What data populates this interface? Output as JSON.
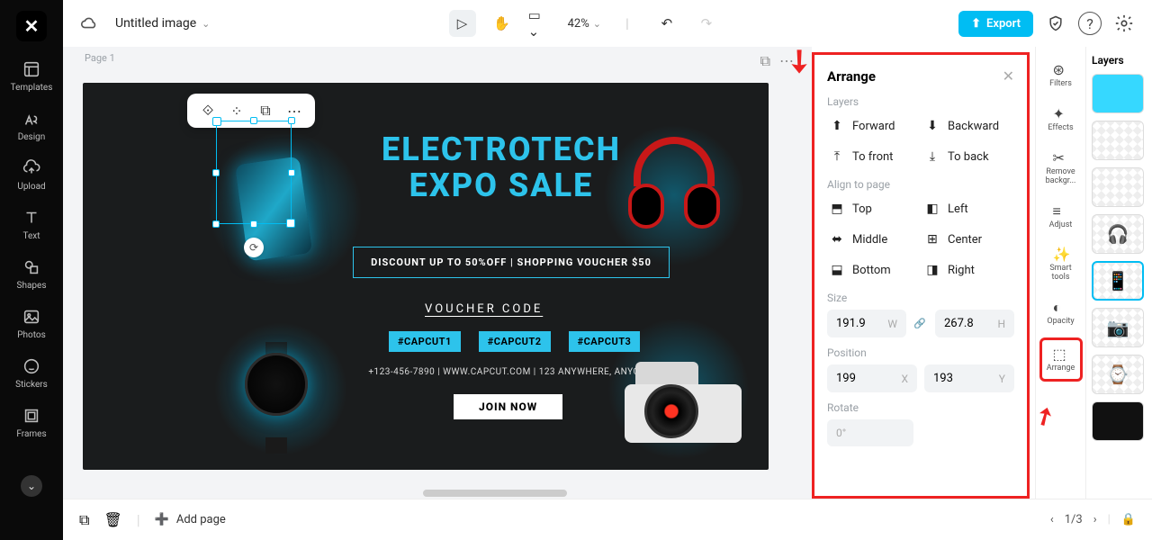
{
  "app": {
    "title": "Untitled image",
    "zoom": "42%",
    "page_label": "Page 1"
  },
  "topbar": {
    "export_label": "Export"
  },
  "rail": {
    "templates": "Templates",
    "design": "Design",
    "upload": "Upload",
    "text": "Text",
    "shapes": "Shapes",
    "photos": "Photos",
    "stickers": "Stickers",
    "frames": "Frames"
  },
  "canvas": {
    "headline": "ELECTROTECH EXPO SALE",
    "subline": "DISCOUNT UP TO 50%OFF    |    SHOPPING VOUCHER $50",
    "voucher_label": "VOUCHER CODE",
    "tags": [
      "#CAPCUT1",
      "#CAPCUT2",
      "#CAPCUT3"
    ],
    "info": "+123-456-7890   |   WWW.CAPCUT.COM   |   123 ANYWHERE, ANYCITY",
    "join": "JOIN NOW"
  },
  "arrange": {
    "title": "Arrange",
    "layers_label": "Layers",
    "forward": "Forward",
    "backward": "Backward",
    "to_front": "To front",
    "to_back": "To back",
    "align_label": "Align to page",
    "top": "Top",
    "left": "Left",
    "middle": "Middle",
    "center": "Center",
    "bottom": "Bottom",
    "right": "Right",
    "size_label": "Size",
    "w_val": "191.9",
    "h_val": "267.8",
    "position_label": "Position",
    "x_val": "199",
    "y_val": "193",
    "rotate_label": "Rotate",
    "rot_val": "0°"
  },
  "tools": {
    "filters": "Filters",
    "effects": "Effects",
    "removebg": "Remove backgr...",
    "adjust": "Adjust",
    "smart": "Smart tools",
    "opacity": "Opacity",
    "arrange": "Arrange"
  },
  "layers_title": "Layers",
  "bottom": {
    "add_page": "Add page",
    "pager": "1/3"
  }
}
